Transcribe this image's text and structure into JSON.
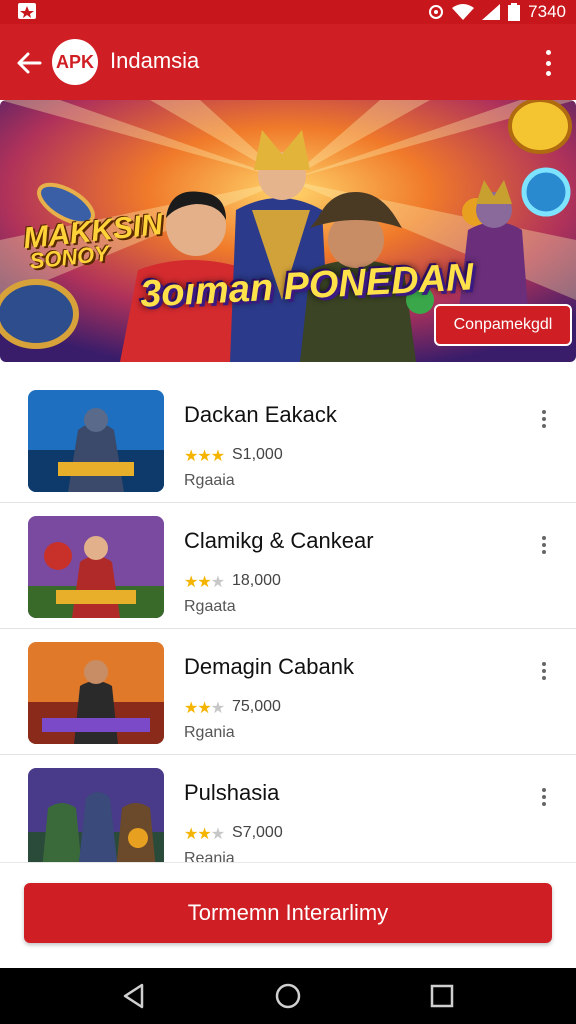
{
  "status_bar": {
    "time": "7340"
  },
  "app_bar": {
    "logo_text": "APK",
    "title": "Indamsia"
  },
  "banner": {
    "logo_line1": "MAKKSIN",
    "logo_line2": "SONOY",
    "title": "3oıman PONEDAN",
    "button_label": "Conpamekgdl"
  },
  "items": [
    {
      "name": "Dackan Eakack",
      "rating": 3,
      "count": "S1,000",
      "tag": "Rgaaia"
    },
    {
      "name": "Clamikg & Cankear",
      "rating": 2.5,
      "count": "18,000",
      "tag": "Rgaata"
    },
    {
      "name": "Demagin Cabank",
      "rating": 2.5,
      "count": "75,000",
      "tag": "Rgania"
    },
    {
      "name": "Pulshasia",
      "rating": 2.5,
      "count": "S7,000",
      "tag": "Reania"
    }
  ],
  "cta": {
    "label": "Tormemn Interarlimy"
  },
  "colors": {
    "primary": "#d01f24",
    "status": "#c8171c",
    "star": "#f4b400"
  }
}
